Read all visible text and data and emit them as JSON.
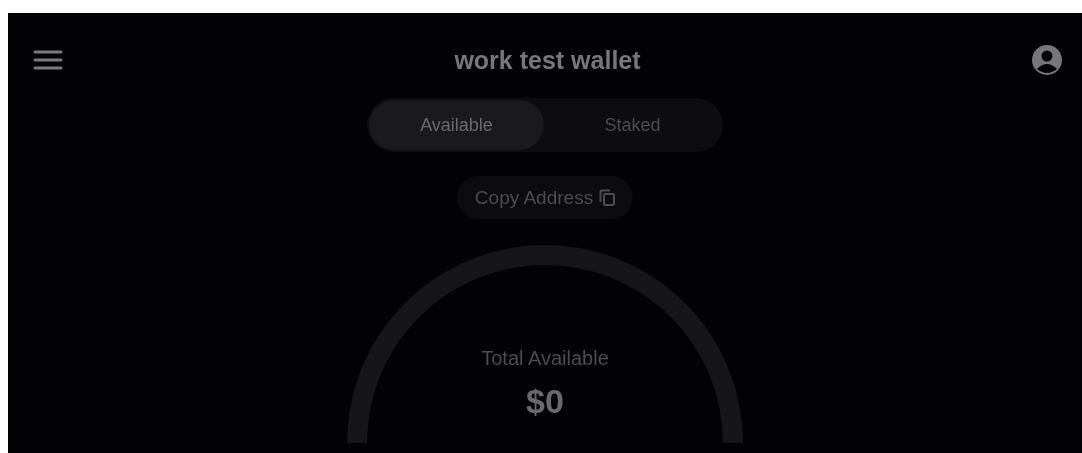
{
  "header": {
    "title": "work test wallet"
  },
  "tabs": [
    {
      "label": "Available",
      "selected": true
    },
    {
      "label": "Staked",
      "selected": false
    }
  ],
  "copy_address": {
    "label": "Copy Address"
  },
  "balance": {
    "label": "Total Available",
    "value": "$0"
  }
}
